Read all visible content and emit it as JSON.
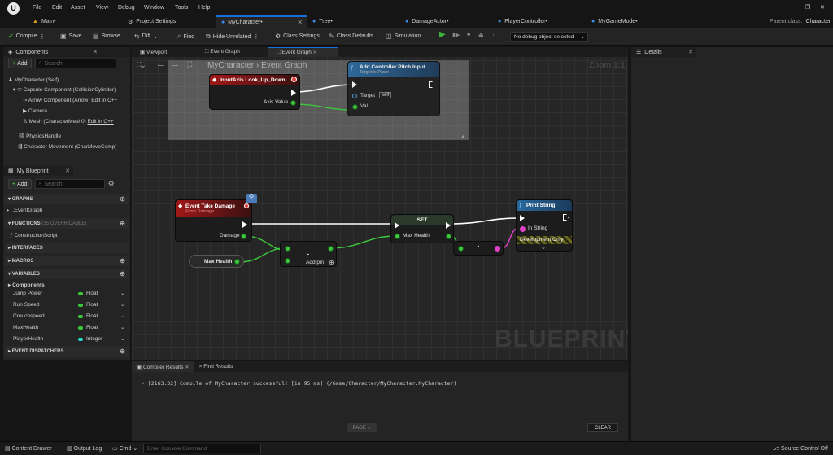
{
  "app": {
    "logo": "U"
  },
  "menu": [
    "File",
    "Edit",
    "Asset",
    "View",
    "Debug",
    "Window",
    "Tools",
    "Help"
  ],
  "window_controls": {
    "minimize": "–",
    "restore": "❐",
    "close": "✕"
  },
  "parent_class": {
    "label": "Parent class:",
    "value": "Character"
  },
  "tabs": [
    {
      "label": "Main•",
      "icon": "level-icon"
    },
    {
      "label": "Project Settings",
      "icon": "gear-icon"
    },
    {
      "label": "MyCharacter•",
      "icon": "blueprint-icon",
      "active": true
    },
    {
      "label": "Tree•",
      "icon": "blueprint-icon"
    },
    {
      "label": "DamageActor•",
      "icon": "blueprint-icon"
    },
    {
      "label": "PlayerController•",
      "icon": "blueprint-icon"
    },
    {
      "label": "MyGameMode•",
      "icon": "blueprint-icon"
    }
  ],
  "toolbar": {
    "compile": "Compile",
    "save": "Save",
    "browse": "Browse",
    "diff": "Diff",
    "find": "Find",
    "hide_unrelated": "Hide Unrelated",
    "class_settings": "Class Settings",
    "class_defaults": "Class Defaults",
    "simulation": "Simulation",
    "debug_object": "No debug object selected"
  },
  "components_panel": {
    "title": "Components",
    "add": "Add",
    "search_placeholder": "Search",
    "items": [
      {
        "label": "MyCharacter (Self)"
      },
      {
        "label": "Capsule Component (CollisionCylinder)"
      },
      {
        "label": "Arrow Component (Arrow)",
        "link": "Edit in C++"
      },
      {
        "label": "Camera"
      },
      {
        "label": "Mesh (CharacterMesh0)",
        "link": "Edit in C++"
      },
      {
        "label": "PhysicsHandle"
      },
      {
        "label": "Character Movement (CharMoveComp)"
      }
    ]
  },
  "my_blueprint": {
    "title": "My Blueprint",
    "add": "Add",
    "search_placeholder": "Search",
    "sections": {
      "graphs": "GRAPHS",
      "event_graph": "EventGraph",
      "functions": "FUNCTIONS",
      "functions_note": "(35 OVERRIDABLE)",
      "construction_script": "ConstructionScript",
      "interfaces": "INTERFACES",
      "macros": "MACROS",
      "variables": "VARIABLES",
      "components": "Components",
      "event_dispatchers": "EVENT DISPATCHERS"
    },
    "variables": [
      {
        "name": "Jump Power",
        "type": "Float",
        "color": "#3cc83c"
      },
      {
        "name": "Run Speed",
        "type": "Float",
        "color": "#3cc83c"
      },
      {
        "name": "Crouchspeed",
        "type": "Float",
        "color": "#3cc83c"
      },
      {
        "name": "MaxHealth",
        "type": "Float",
        "color": "#3cc83c"
      },
      {
        "name": "PlayerHealth",
        "type": "Integer",
        "color": "#29d6c8"
      }
    ]
  },
  "graph": {
    "tabs": [
      "Viewport",
      "Event Graph",
      "Event Graph"
    ],
    "breadcrumb": {
      "root": "MyCharacter",
      "sep": "›",
      "current": "Event Graph"
    },
    "zoom": "Zoom 1:1",
    "watermark": "BLUEPRINT",
    "nodes": {
      "input_axis": {
        "title": "InputAxis Look_Up_Down",
        "pin": "Axis Value"
      },
      "add_pitch": {
        "title": "Add Controller Pitch Input",
        "subtitle": "Target is Pawn",
        "target": "Target",
        "self": "self",
        "val": "Val"
      },
      "take_damage": {
        "title": "Event Take Damage",
        "subtitle": "From Damage",
        "pin": "Damage"
      },
      "max_health_get": {
        "label": "Max Health"
      },
      "subtract": {
        "op": "-",
        "add_pin": "Add pin"
      },
      "set": {
        "title": "SET",
        "pin": "Max Health"
      },
      "conv": {
        "label": "•"
      },
      "print": {
        "title": "Print String",
        "in": "In String",
        "dev": "Development Only"
      }
    }
  },
  "details": {
    "title": "Details"
  },
  "compiler": {
    "tabs": [
      "Compiler Results",
      "Find Results"
    ],
    "message": "[2163.32] Compile of MyCharacter successful! [in 95 ms] (/Game/Character/MyCharacter.MyCharacter)",
    "page": "PAGE",
    "clear": "CLEAR"
  },
  "bottom": {
    "content_drawer": "Content Drawer",
    "output_log": "Output Log",
    "cmd": "Cmd",
    "console_placeholder": "Enter Console Command",
    "source_control": "Source Control Off"
  }
}
